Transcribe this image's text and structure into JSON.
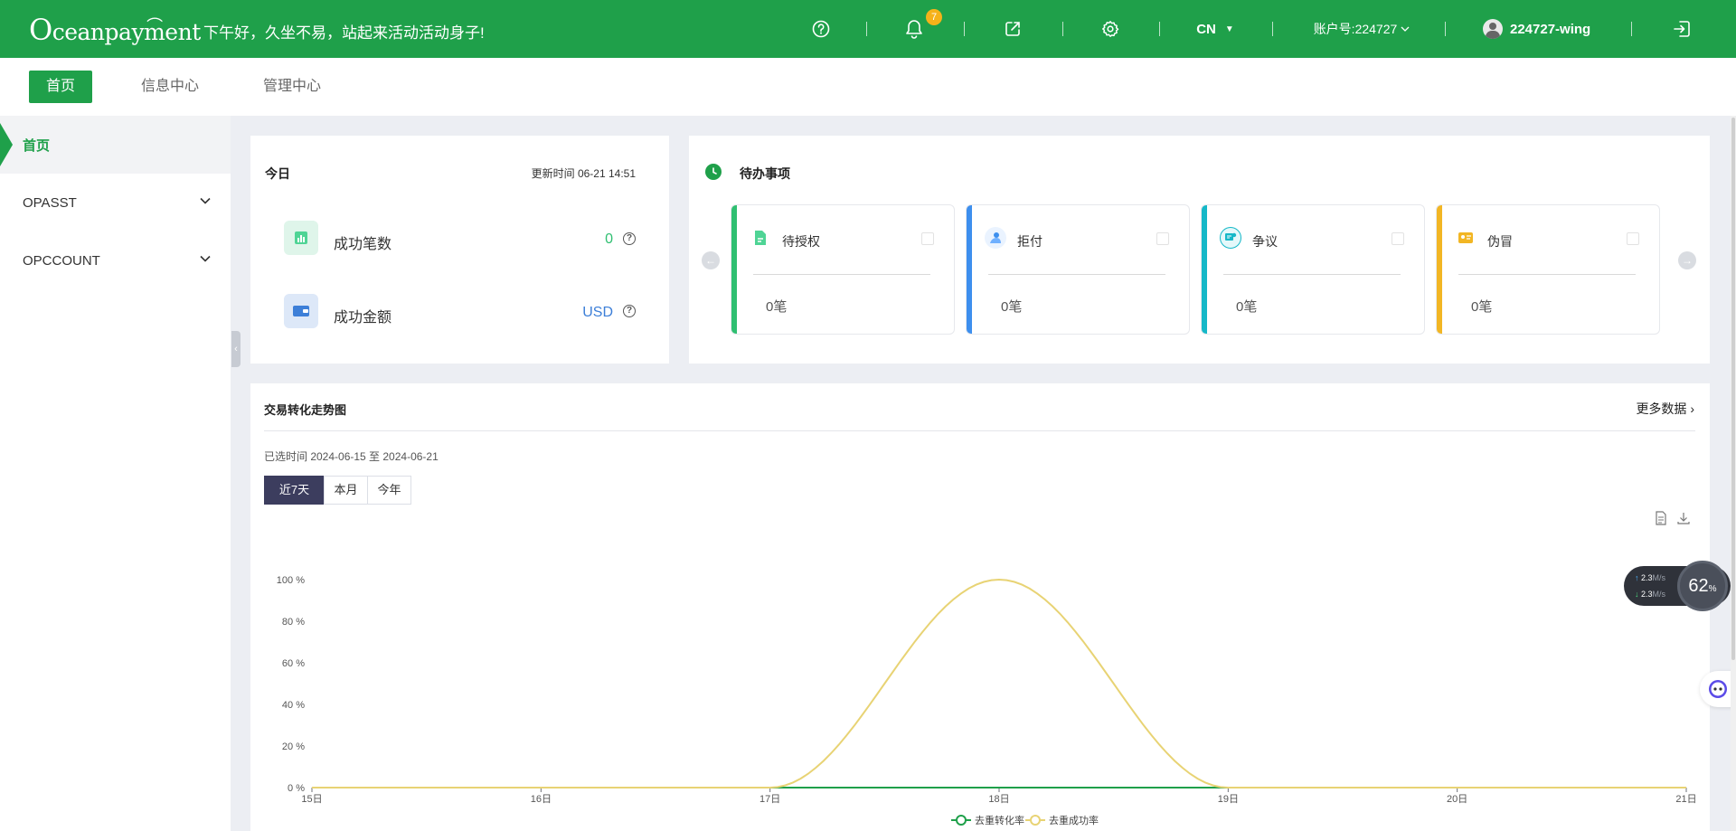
{
  "header": {
    "logo": "Oceanpayment",
    "greeting": "下午好，久坐不易，站起来活动活动身子!",
    "notification_count": "7",
    "language": "CN",
    "account": "账户号:224727",
    "username": "224727-wing",
    "icons": [
      "help-icon",
      "bell-icon",
      "external-link-icon",
      "settings-icon",
      "logout-icon"
    ]
  },
  "nav": {
    "tabs": [
      {
        "label": "首页",
        "active": true
      },
      {
        "label": "信息中心",
        "active": false
      },
      {
        "label": "管理中心",
        "active": false
      }
    ]
  },
  "sidebar": {
    "items": [
      {
        "label": "首页",
        "active": true
      },
      {
        "label": "OPASST",
        "expandable": true
      },
      {
        "label": "OPCCOUNT",
        "expandable": true
      }
    ]
  },
  "today": {
    "title": "今日",
    "update_time": "更新时间 06-21 14:51",
    "metrics": [
      {
        "label": "成功笔数",
        "value": "0",
        "value_color": "#2fbf71",
        "icon": "bar-chart-icon"
      },
      {
        "label": "成功金额",
        "value": "USD",
        "value_color": "#3d7fd8",
        "icon": "wallet-icon"
      }
    ]
  },
  "todo": {
    "title": "待办事项",
    "items": [
      {
        "label": "待授权",
        "count": "0笔",
        "color": "#2fbf71",
        "icon": "document-icon"
      },
      {
        "label": "拒付",
        "count": "0笔",
        "color": "#3d8fee",
        "icon": "person-icon"
      },
      {
        "label": "争议",
        "count": "0笔",
        "color": "#15b8c8",
        "icon": "chat-icon"
      },
      {
        "label": "伪冒",
        "count": "0笔",
        "color": "#f2b624",
        "icon": "id-card-icon"
      }
    ]
  },
  "trend": {
    "title": "交易转化走势图",
    "more": "更多数据",
    "range": "已选时间 2024-06-15 至 2024-06-21",
    "periods": [
      {
        "label": "近7天",
        "active": true
      },
      {
        "label": "本月",
        "active": false
      },
      {
        "label": "今年",
        "active": false
      }
    ]
  },
  "chart_data": {
    "type": "line",
    "x": [
      "15日",
      "16日",
      "17日",
      "18日",
      "19日",
      "20日",
      "21日"
    ],
    "series": [
      {
        "name": "去重转化率",
        "color": "#1fa04a",
        "values": [
          0,
          0,
          0,
          0,
          0,
          0,
          0
        ]
      },
      {
        "name": "去重成功率",
        "color": "#e8d374",
        "values": [
          0,
          0,
          0,
          100,
          0,
          0,
          0
        ]
      }
    ],
    "yticks": [
      "0 %",
      "20 %",
      "40 %",
      "60 %",
      "80 %",
      "100 %"
    ],
    "ylim": [
      0,
      100
    ],
    "smooth": true,
    "legend": "bottom-center"
  },
  "network": {
    "up": "2.3",
    "down": "2.3",
    "unit": "M/s",
    "percent": "62",
    "percent_unit": "%"
  }
}
